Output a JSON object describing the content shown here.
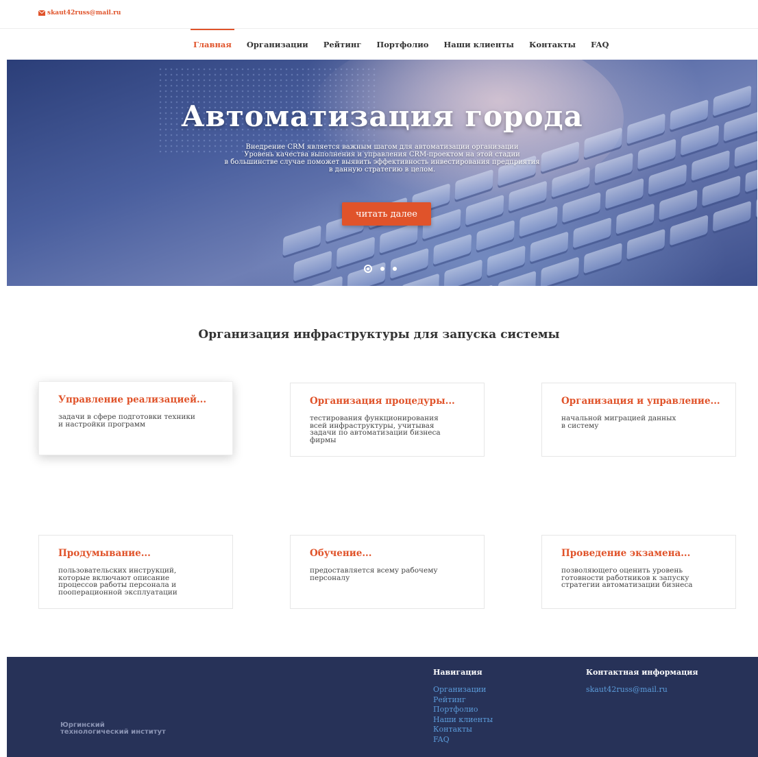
{
  "topbar": {
    "email": "skaut42russ@mail.ru"
  },
  "nav": {
    "items": [
      {
        "label": "Главная",
        "active": true
      },
      {
        "label": "Организации"
      },
      {
        "label": "Рейтинг"
      },
      {
        "label": "Портфолио"
      },
      {
        "label": "Наши клиенты"
      },
      {
        "label": "Контакты"
      },
      {
        "label": "FAQ"
      }
    ]
  },
  "hero": {
    "title": "Автоматизация города",
    "lead": [
      "Внедрение CRM является важным шагом для автоматизации организации",
      "Уровень качества выполнения и управления CRM-проектом на этой стадии",
      "в большинстве случае поможет выявить эффективность инвестирования предприятия",
      "в данную стратегию в целом."
    ],
    "button": "читать далее",
    "slides": 3,
    "active_slide": 1
  },
  "section": {
    "title": "Организация инфраструктуры для запуска системы",
    "cards": [
      {
        "title": "Управление реализацией...",
        "text": [
          "задачи в сфере подготовки техники",
          "и настройки программ"
        ]
      },
      {
        "title": "Организация процедуры...",
        "text": [
          "тестирования функционирования",
          "всей инфраструктуры, учитывая",
          "задачи по автоматизации бизнеса",
          "фирмы"
        ]
      },
      {
        "title": "Организация и управление...",
        "text": [
          "начальной миграцией данных",
          "в систему"
        ]
      },
      {
        "title": "Продумывание...",
        "text": [
          "пользовательских инструкций,",
          "которые включают описание",
          "процессов работы персонала и",
          "пооперационной эксплуатации"
        ]
      },
      {
        "title": "Обучение...",
        "text": [
          "предоставляется всему рабочему",
          "персоналу"
        ]
      },
      {
        "title": "Проведение экзамена...",
        "text": [
          "позволяющего оценить уровень",
          "готовности работников к запуску",
          "стратегии автоматизации бизнеса"
        ]
      }
    ]
  },
  "footer": {
    "logo": [
      "Юргинский",
      "технологический институт"
    ],
    "nav_title": "Навигация",
    "nav_links": [
      "Организации",
      "Рейтинг",
      "Портфолио",
      "Наши клиенты",
      "Контакты",
      "FAQ"
    ],
    "contact_title": "Контактная информация",
    "contact_email": "skaut42russ@mail.ru"
  },
  "colors": {
    "accent": "#e0532a",
    "footer_bg": "#273258",
    "link": "#5b9bd9"
  }
}
